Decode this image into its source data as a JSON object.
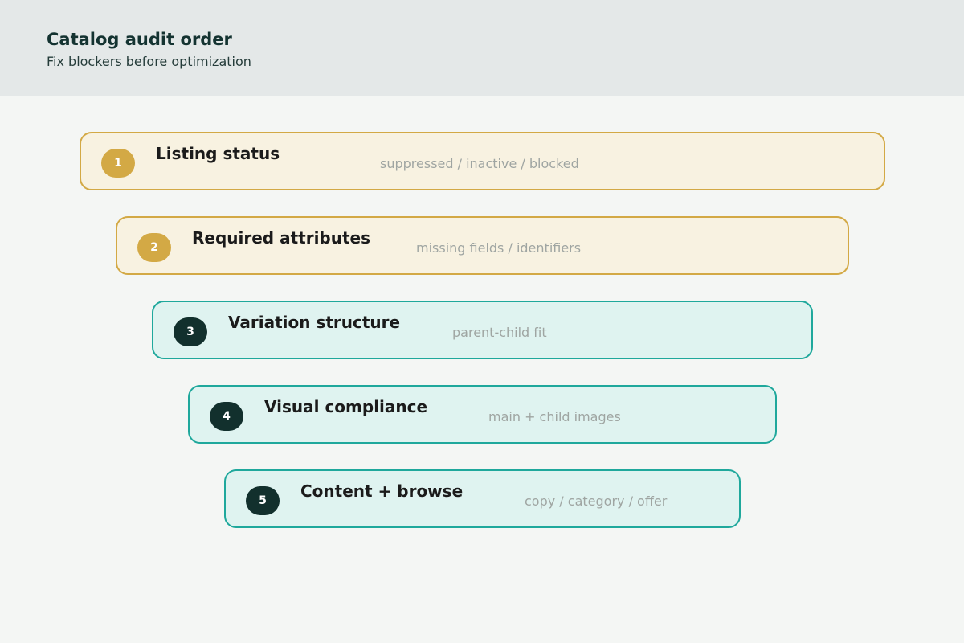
{
  "header": {
    "title": "Catalog audit order",
    "subtitle": "Fix blockers before optimization"
  },
  "steps": [
    {
      "number": "1",
      "label": "Listing status",
      "note": "suppressed / inactive / blocked",
      "tone": "warm"
    },
    {
      "number": "2",
      "label": "Required attributes",
      "note": "missing fields / identifiers",
      "tone": "warm"
    },
    {
      "number": "3",
      "label": "Variation structure",
      "note": "parent-child fit",
      "tone": "cool"
    },
    {
      "number": "4",
      "label": "Visual compliance",
      "note": "main + child images",
      "tone": "cool"
    },
    {
      "number": "5",
      "label": "Content + browse",
      "note": "copy / category / offer",
      "tone": "cool"
    }
  ],
  "colors": {
    "warm_accent": "#d3a945",
    "cool_accent": "#1fa89c",
    "dark_badge": "#12302d"
  }
}
